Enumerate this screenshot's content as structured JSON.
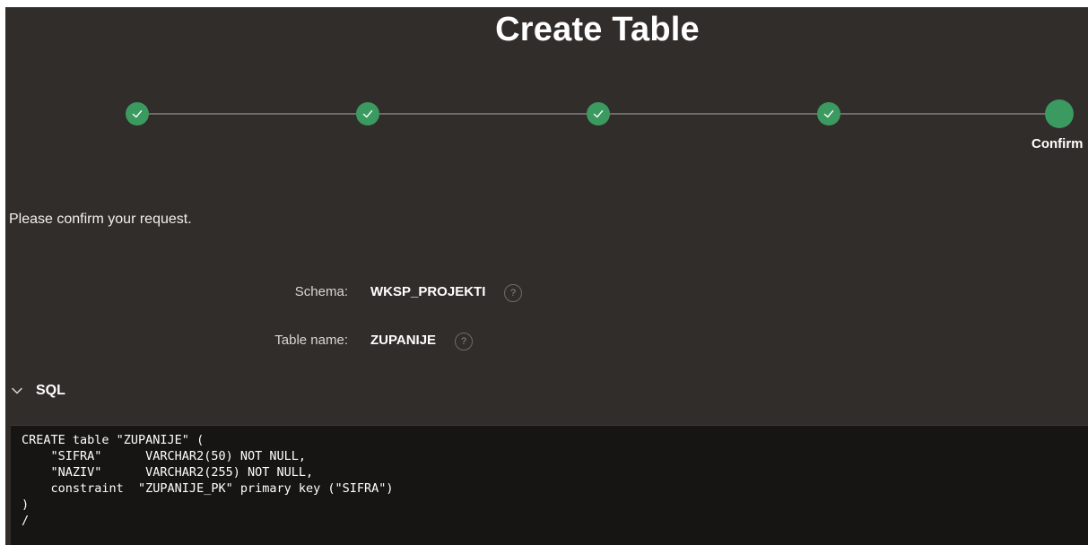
{
  "page": {
    "title": "Create Table"
  },
  "wizard": {
    "steps": [
      {
        "status": "complete",
        "label": ""
      },
      {
        "status": "complete",
        "label": ""
      },
      {
        "status": "complete",
        "label": ""
      },
      {
        "status": "complete",
        "label": ""
      },
      {
        "status": "current",
        "label": "Confirm"
      }
    ],
    "current_step_label": "Confirm"
  },
  "message": "Please confirm your request.",
  "fields": {
    "schema": {
      "label": "Schema:",
      "value": "WKSP_PROJEKTI"
    },
    "table_name": {
      "label": "Table name:",
      "value": "ZUPANIJE"
    }
  },
  "help_icon": "?",
  "sql_section": {
    "label": "SQL",
    "expanded": true,
    "code_lines": [
      "CREATE table \"ZUPANIJE\" (",
      "    \"SIFRA\"      VARCHAR2(50) NOT NULL,",
      "    \"NAZIV\"      VARCHAR2(255) NOT NULL,",
      "    constraint  \"ZUPANIJE_PK\" primary key (\"SIFRA\")",
      ")",
      "/"
    ]
  },
  "colors": {
    "background": "#312d2a",
    "step_complete": "#3a9a5f",
    "code_background": "#161513"
  }
}
